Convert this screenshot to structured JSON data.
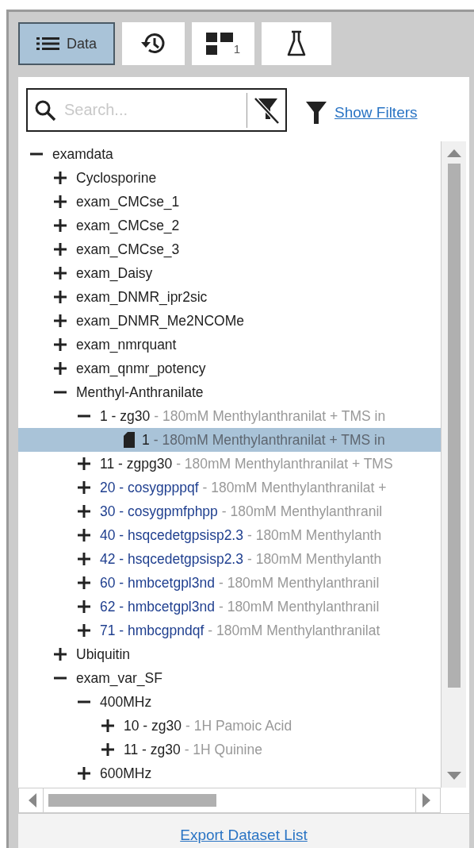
{
  "tabs": [
    {
      "kind": "list",
      "label": "Data",
      "selected": true
    },
    {
      "kind": "history",
      "selected": false
    },
    {
      "kind": "layout",
      "badge": "1",
      "selected": false
    },
    {
      "kind": "flask",
      "selected": false
    }
  ],
  "search": {
    "placeholder": "Search..."
  },
  "filters_link": "Show Filters",
  "tree": [
    {
      "label": "examdata",
      "expanded": true,
      "selected": false,
      "children": [
        {
          "label": "Cyclosporine",
          "expanded": false,
          "selected": false
        },
        {
          "label": "exam_CMCse_1",
          "expanded": false,
          "selected": false
        },
        {
          "label": "exam_CMCse_2",
          "expanded": false,
          "selected": false
        },
        {
          "label": "exam_CMCse_3",
          "expanded": false,
          "selected": false
        },
        {
          "label": "exam_Daisy",
          "expanded": false,
          "selected": false
        },
        {
          "label": "exam_DNMR_ipr2sic",
          "expanded": false,
          "selected": false
        },
        {
          "label": "exam_DNMR_Me2NCOMe",
          "expanded": false,
          "selected": false
        },
        {
          "label": "exam_nmrquant",
          "expanded": false,
          "selected": false
        },
        {
          "label": "exam_qnmr_potency",
          "expanded": false,
          "selected": false
        },
        {
          "label": "Menthyl-Anthranilate",
          "expanded": true,
          "selected": false,
          "children": [
            {
              "label": "1 - zg30",
              "description": "- 180mM Menthylanthranilat + TMS in",
              "color": "#222222",
              "expanded": true,
              "selected": false,
              "children": [
                {
                  "kind": "file",
                  "label": "1",
                  "description": "- 180mM Menthylanthranilat + TMS in",
                  "selected": true
                }
              ]
            },
            {
              "label": "11 - zgpg30",
              "description": "- 180mM Menthylanthranilat + TMS",
              "color": "#222222",
              "expanded": false,
              "selected": false
            },
            {
              "label": "20 - cosygpppqf",
              "description": "- 180mM Menthylanthranilat +",
              "color": "#1f3f8f",
              "expanded": false,
              "selected": false
            },
            {
              "label": "30 - cosygpmfphpp",
              "description": "- 180mM Menthylanthranil",
              "color": "#1f3f8f",
              "expanded": false,
              "selected": false
            },
            {
              "label": "40 - hsqcedetgpsisp2.3",
              "description": "- 180mM Menthylanth",
              "color": "#1f3f8f",
              "expanded": false,
              "selected": false
            },
            {
              "label": "42 - hsqcedetgpsisp2.3",
              "description": "- 180mM Menthylanth",
              "color": "#1f3f8f",
              "expanded": false,
              "selected": false
            },
            {
              "label": "60 - hmbcetgpl3nd",
              "description": "- 180mM Menthylanthranil",
              "color": "#1f3f8f",
              "expanded": false,
              "selected": false
            },
            {
              "label": "62 - hmbcetgpl3nd",
              "description": "- 180mM Menthylanthranil",
              "color": "#1f3f8f",
              "expanded": false,
              "selected": false
            },
            {
              "label": "71 - hmbcgpndqf",
              "description": "- 180mM Menthylanthranilat",
              "color": "#1f3f8f",
              "expanded": false,
              "selected": false
            }
          ]
        },
        {
          "label": "Ubiquitin",
          "expanded": false,
          "selected": false
        },
        {
          "label": "exam_var_SF",
          "expanded": true,
          "selected": false,
          "children": [
            {
              "label": "400MHz",
              "expanded": true,
              "selected": false,
              "children": [
                {
                  "label": "10 - zg30",
                  "description": "- 1H Pamoic Acid",
                  "color": "#222222",
                  "expanded": false,
                  "selected": false
                },
                {
                  "label": "11 - zg30",
                  "description": "- 1H Quinine",
                  "color": "#222222",
                  "expanded": false,
                  "selected": false
                }
              ]
            },
            {
              "label": "600MHz",
              "expanded": false,
              "selected": false
            }
          ]
        }
      ]
    }
  ],
  "export_link": "Export Dataset List"
}
